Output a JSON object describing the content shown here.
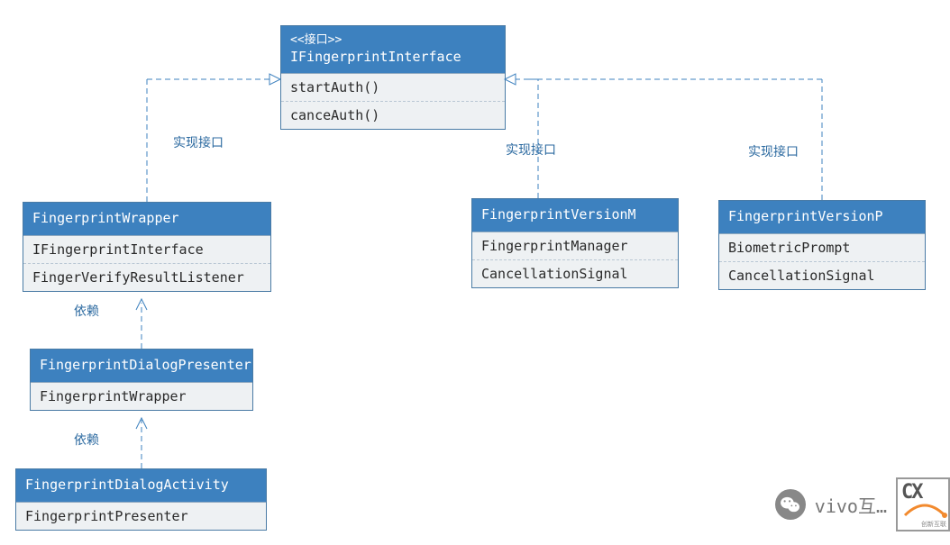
{
  "interface": {
    "stereotype": "<<接口>>",
    "name": "IFingerprintInterface",
    "methods": [
      "startAuth()",
      "canceAuth()"
    ]
  },
  "wrapper": {
    "name": "FingerprintWrapper",
    "members": [
      "IFingerprintInterface",
      "FingerVerifyResultListener"
    ]
  },
  "versionM": {
    "name": "FingerprintVersionM",
    "members": [
      "FingerprintManager",
      "CancellationSignal"
    ]
  },
  "versionP": {
    "name": "FingerprintVersionP",
    "members": [
      "BiometricPrompt",
      "CancellationSignal"
    ]
  },
  "presenter": {
    "name": "FingerprintDialogPresenter",
    "members": [
      "FingerprintWrapper"
    ]
  },
  "activity": {
    "name": "FingerprintDialogActivity",
    "members": [
      "FingerprintPresenter"
    ]
  },
  "labels": {
    "realize": "实现接口",
    "depend": "依赖"
  },
  "watermark": {
    "brand": "vivo互…",
    "badge": "创新互联"
  },
  "chart_data": {
    "type": "table",
    "description": "UML-style class diagram of Android fingerprint authentication classes",
    "nodes": [
      {
        "id": "IFingerprintInterface",
        "stereotype": "接口",
        "methods": [
          "startAuth()",
          "canceAuth()"
        ]
      },
      {
        "id": "FingerprintWrapper",
        "attributes": [
          "IFingerprintInterface",
          "FingerVerifyResultListener"
        ]
      },
      {
        "id": "FingerprintVersionM",
        "attributes": [
          "FingerprintManager",
          "CancellationSignal"
        ]
      },
      {
        "id": "FingerprintVersionP",
        "attributes": [
          "BiometricPrompt",
          "CancellationSignal"
        ]
      },
      {
        "id": "FingerprintDialogPresenter",
        "attributes": [
          "FingerprintWrapper"
        ]
      },
      {
        "id": "FingerprintDialogActivity",
        "attributes": [
          "FingerprintPresenter"
        ]
      }
    ],
    "edges": [
      {
        "from": "FingerprintWrapper",
        "to": "IFingerprintInterface",
        "relation": "realization",
        "label": "实现接口"
      },
      {
        "from": "FingerprintVersionM",
        "to": "IFingerprintInterface",
        "relation": "realization",
        "label": "实现接口"
      },
      {
        "from": "FingerprintVersionP",
        "to": "IFingerprintInterface",
        "relation": "realization",
        "label": "实现接口"
      },
      {
        "from": "FingerprintDialogPresenter",
        "to": "FingerprintWrapper",
        "relation": "dependency",
        "label": "依赖"
      },
      {
        "from": "FingerprintDialogActivity",
        "to": "FingerprintDialogPresenter",
        "relation": "dependency",
        "label": "依赖"
      }
    ]
  }
}
